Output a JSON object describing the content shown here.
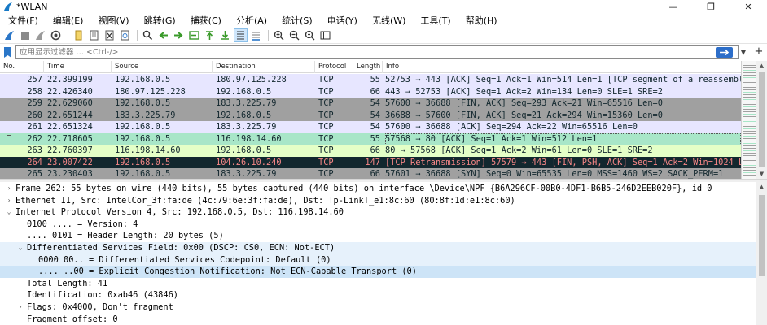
{
  "window": {
    "title": "*WLAN",
    "minimize": "—",
    "maximize": "❐",
    "close": "✕"
  },
  "menu": [
    "文件(F)",
    "编辑(E)",
    "视图(V)",
    "跳转(G)",
    "捕获(C)",
    "分析(A)",
    "统计(S)",
    "电话(Y)",
    "无线(W)",
    "工具(T)",
    "帮助(H)"
  ],
  "toolbar": [
    "start-capture-icon",
    "stop-capture-icon",
    "restart-capture-icon",
    "capture-options-icon",
    "open-file-icon",
    "save-file-icon",
    "close-file-icon",
    "reload-file-icon",
    "find-packet-icon",
    "go-back-icon",
    "go-forward-icon",
    "go-to-packet-icon",
    "first-packet-icon",
    "last-packet-icon",
    "autoscroll-icon",
    "colorize-icon",
    "zoom-in-icon",
    "zoom-out-icon",
    "normal-size-icon",
    "resize-columns-icon"
  ],
  "filter": {
    "placeholder": "应用显示过滤器 … <Ctrl-/>",
    "plus": "+"
  },
  "columns": [
    "No.",
    "Time",
    "Source",
    "Destination",
    "Protocol",
    "Length",
    "Info"
  ],
  "packets": [
    {
      "no": "257",
      "time": "22.399199",
      "src": "192.168.0.5",
      "dst": "180.97.125.228",
      "proto": "TCP",
      "len": "55",
      "info": "52753 → 443 [ACK] Seq=1 Ack=1 Win=514 Len=1 [TCP segment of a reassemble…",
      "bg": "#e7e6ff",
      "fg": "#12272e"
    },
    {
      "no": "258",
      "time": "22.426340",
      "src": "180.97.125.228",
      "dst": "192.168.0.5",
      "proto": "TCP",
      "len": "66",
      "info": "443 → 52753 [ACK] Seq=1 Ack=2 Win=134 Len=0 SLE=1 SRE=2",
      "bg": "#e7e6ff",
      "fg": "#12272e"
    },
    {
      "no": "259",
      "time": "22.629060",
      "src": "192.168.0.5",
      "dst": "183.3.225.79",
      "proto": "TCP",
      "len": "54",
      "info": "57600 → 36688 [FIN, ACK] Seq=293 Ack=21 Win=65516 Len=0",
      "bg": "#a0a0a0",
      "fg": "#12272e"
    },
    {
      "no": "260",
      "time": "22.651244",
      "src": "183.3.225.79",
      "dst": "192.168.0.5",
      "proto": "TCP",
      "len": "54",
      "info": "36688 → 57600 [FIN, ACK] Seq=21 Ack=294 Win=15360 Len=0",
      "bg": "#a0a0a0",
      "fg": "#12272e"
    },
    {
      "no": "261",
      "time": "22.651324",
      "src": "192.168.0.5",
      "dst": "183.3.225.79",
      "proto": "TCP",
      "len": "54",
      "info": "57600 → 36688 [ACK] Seq=294 Ack=22 Win=65516 Len=0",
      "bg": "#e7e6ff",
      "fg": "#12272e"
    },
    {
      "no": "262",
      "time": "22.718605",
      "src": "192.168.0.5",
      "dst": "116.198.14.60",
      "proto": "TCP",
      "len": "55",
      "info": "57568 → 80 [ACK] Seq=1 Ack=1 Win=512 Len=1",
      "bg": "#a8e6c8",
      "fg": "#12272e",
      "selected": true
    },
    {
      "no": "263",
      "time": "22.760397",
      "src": "116.198.14.60",
      "dst": "192.168.0.5",
      "proto": "TCP",
      "len": "66",
      "info": "80 → 57568 [ACK] Seq=1 Ack=2 Win=61 Len=0 SLE=1 SRE=2",
      "bg": "#e4ffc7",
      "fg": "#12272e"
    },
    {
      "no": "264",
      "time": "23.007422",
      "src": "192.168.0.5",
      "dst": "104.26.10.240",
      "proto": "TCP",
      "len": "147",
      "info": "[TCP Retransmission] 57579 → 443 [FIN, PSH, ACK] Seq=1 Ack=2 Win=1024 Le…",
      "bg": "#12272e",
      "fg": "#f78787"
    },
    {
      "no": "265",
      "time": "23.230403",
      "src": "192.168.0.5",
      "dst": "183.3.225.79",
      "proto": "TCP",
      "len": "66",
      "info": "57601 → 36688 [SYN] Seq=0 Win=65535 Len=0 MSS=1460 WS=2 SACK_PERM=1",
      "bg": "#a0a0a0",
      "fg": "#12272e"
    }
  ],
  "details": [
    {
      "toggle": "›",
      "level": 0,
      "text": "Frame 262: 55 bytes on wire (440 bits), 55 bytes captured (440 bits) on interface \\Device\\NPF_{B6A296CF-00B0-4DF1-B6B5-246D2EEB020F}, id 0"
    },
    {
      "toggle": "›",
      "level": 0,
      "text": "Ethernet II, Src: IntelCor_3f:fa:de (4c:79:6e:3f:fa:de), Dst: Tp-LinkT_e1:8c:60 (80:8f:1d:e1:8c:60)"
    },
    {
      "toggle": "⌄",
      "level": 0,
      "text": "Internet Protocol Version 4, Src: 192.168.0.5, Dst: 116.198.14.60"
    },
    {
      "toggle": "",
      "level": 1,
      "text": "0100 .... = Version: 4"
    },
    {
      "toggle": "",
      "level": 1,
      "text": ".... 0101 = Header Length: 20 bytes (5)"
    },
    {
      "toggle": "⌄",
      "level": 1,
      "text": "Differentiated Services Field: 0x00 (DSCP: CS0, ECN: Not-ECT)",
      "style": "hl"
    },
    {
      "toggle": "",
      "level": 2,
      "text": "0000 00.. = Differentiated Services Codepoint: Default (0)",
      "style": "hl"
    },
    {
      "toggle": "",
      "level": 2,
      "text": ".... ..00 = Explicit Congestion Notification: Not ECN-Capable Transport (0)",
      "style": "sel"
    },
    {
      "toggle": "",
      "level": 1,
      "text": "Total Length: 41"
    },
    {
      "toggle": "",
      "level": 1,
      "text": "Identification: 0xab46 (43846)"
    },
    {
      "toggle": "›",
      "level": 1,
      "text": "Flags: 0x4000, Don't fragment"
    },
    {
      "toggle": "",
      "level": 1,
      "text": "Fragment offset: 0"
    }
  ]
}
